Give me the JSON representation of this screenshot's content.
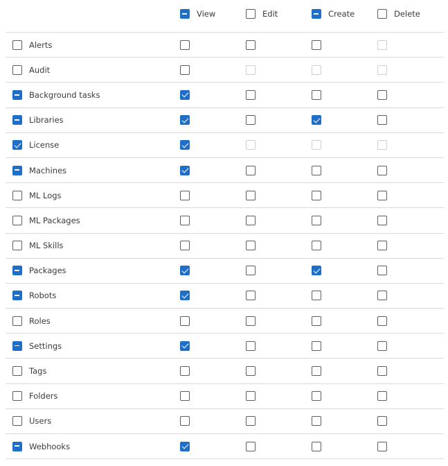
{
  "header": {
    "columns": [
      {
        "label": "View",
        "state": "indeterminate"
      },
      {
        "label": "Edit",
        "state": "unchecked"
      },
      {
        "label": "Create",
        "state": "indeterminate"
      },
      {
        "label": "Delete",
        "state": "unchecked"
      }
    ]
  },
  "rows": [
    {
      "label": "Alerts",
      "state": "unchecked",
      "perms": [
        "unchecked",
        "unchecked",
        "unchecked",
        "disabled"
      ]
    },
    {
      "label": "Audit",
      "state": "unchecked",
      "perms": [
        "unchecked",
        "disabled",
        "disabled",
        "disabled"
      ]
    },
    {
      "label": "Background tasks",
      "state": "indeterminate",
      "perms": [
        "checked",
        "unchecked",
        "unchecked",
        "unchecked"
      ]
    },
    {
      "label": "Libraries",
      "state": "indeterminate",
      "perms": [
        "checked",
        "unchecked",
        "checked",
        "unchecked"
      ]
    },
    {
      "label": "License",
      "state": "checked",
      "perms": [
        "checked",
        "disabled",
        "disabled",
        "disabled"
      ]
    },
    {
      "label": "Machines",
      "state": "indeterminate",
      "perms": [
        "checked",
        "unchecked",
        "unchecked",
        "unchecked"
      ]
    },
    {
      "label": "ML Logs",
      "state": "unchecked",
      "perms": [
        "unchecked",
        "unchecked",
        "unchecked",
        "unchecked"
      ]
    },
    {
      "label": "ML Packages",
      "state": "unchecked",
      "perms": [
        "unchecked",
        "unchecked",
        "unchecked",
        "unchecked"
      ]
    },
    {
      "label": "ML Skills",
      "state": "unchecked",
      "perms": [
        "unchecked",
        "unchecked",
        "unchecked",
        "unchecked"
      ]
    },
    {
      "label": "Packages",
      "state": "indeterminate",
      "perms": [
        "checked",
        "unchecked",
        "checked",
        "unchecked"
      ]
    },
    {
      "label": "Robots",
      "state": "indeterminate",
      "perms": [
        "checked",
        "unchecked",
        "unchecked",
        "unchecked"
      ]
    },
    {
      "label": "Roles",
      "state": "unchecked",
      "perms": [
        "unchecked",
        "unchecked",
        "unchecked",
        "unchecked"
      ]
    },
    {
      "label": "Settings",
      "state": "indeterminate",
      "perms": [
        "checked",
        "unchecked",
        "unchecked",
        "unchecked"
      ]
    },
    {
      "label": "Tags",
      "state": "unchecked",
      "perms": [
        "unchecked",
        "unchecked",
        "unchecked",
        "unchecked"
      ]
    },
    {
      "label": "Folders",
      "state": "unchecked",
      "perms": [
        "unchecked",
        "unchecked",
        "unchecked",
        "unchecked"
      ]
    },
    {
      "label": "Users",
      "state": "unchecked",
      "perms": [
        "unchecked",
        "unchecked",
        "unchecked",
        "unchecked"
      ]
    },
    {
      "label": "Webhooks",
      "state": "indeterminate",
      "perms": [
        "checked",
        "unchecked",
        "unchecked",
        "unchecked"
      ]
    }
  ],
  "colors": {
    "accent": "#1f6fc8",
    "border": "#5e5e5e",
    "disabled": "#cfcfcf",
    "divider": "#d9d9d9",
    "text": "#3b3b3b"
  }
}
